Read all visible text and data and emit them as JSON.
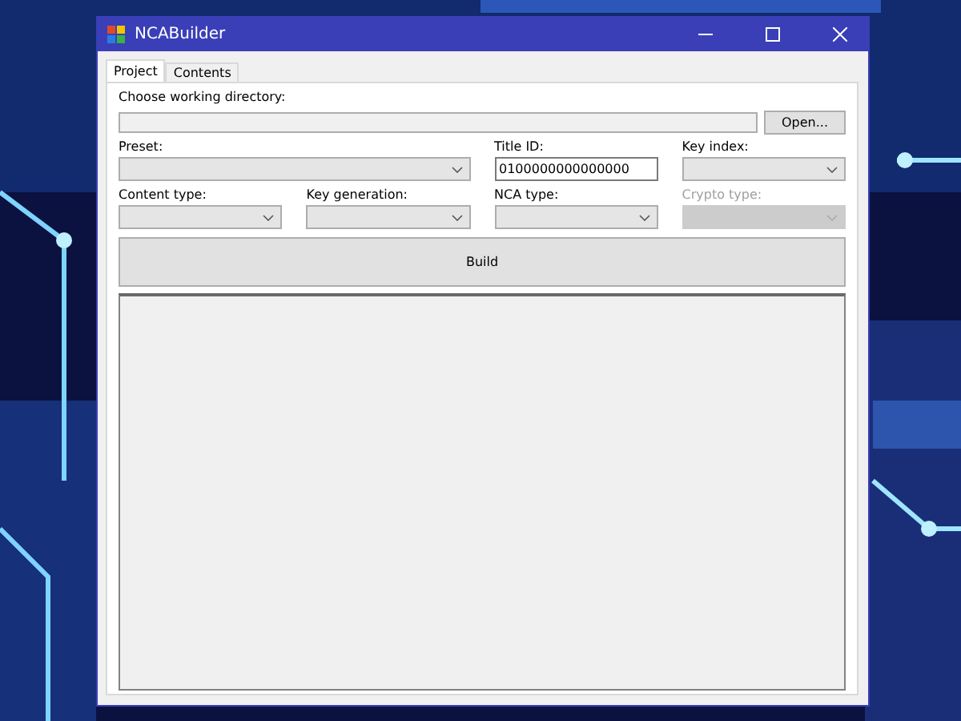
{
  "window": {
    "title": "NCABuilder"
  },
  "tabs": [
    {
      "label": "Project",
      "selected": true
    },
    {
      "label": "Contents",
      "selected": false
    }
  ],
  "directory": {
    "label": "Choose working directory:",
    "button": "Open..."
  },
  "fields": [
    {
      "label": "Preset:",
      "kind": "combo",
      "disabled": false
    },
    {
      "label": "Title ID:",
      "kind": "text",
      "value": "0100000000000000",
      "disabled": false
    },
    {
      "label": "Key index:",
      "kind": "combo",
      "disabled": false
    },
    {
      "label": "Content type:",
      "kind": "combo",
      "disabled": false
    },
    {
      "label": "Key generation:",
      "kind": "combo",
      "disabled": false
    },
    {
      "label": "NCA type:",
      "kind": "combo",
      "disabled": false
    },
    {
      "label": "Crypto type:",
      "kind": "combo",
      "disabled": true
    }
  ],
  "build_button": "Build"
}
